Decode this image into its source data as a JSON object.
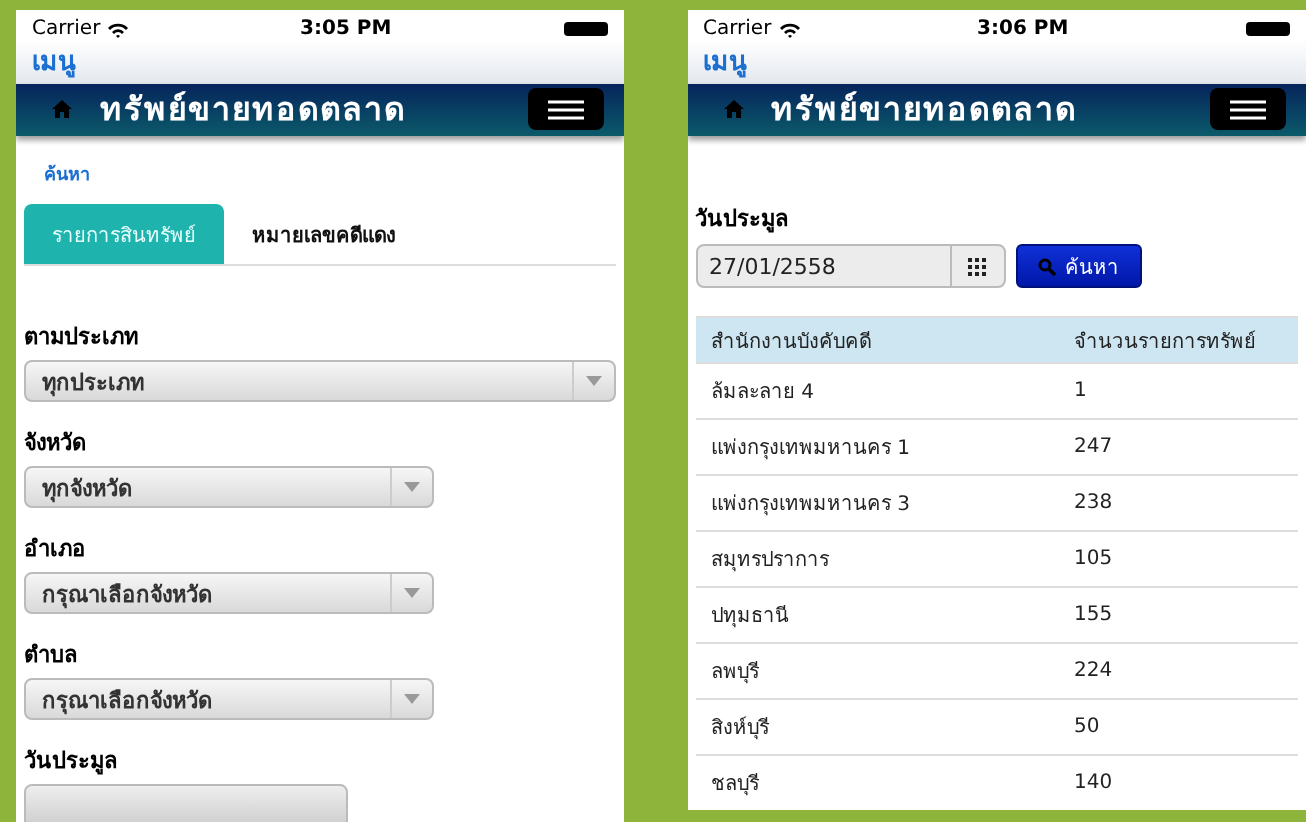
{
  "screens": [
    {
      "kind": "search_form",
      "status_bar": {
        "carrier": "Carrier",
        "time": "3:05 PM"
      },
      "menu_link": "เมนู",
      "header": {
        "title": "ทรัพย์ขายทอดตลาด"
      },
      "search_link": "ค้นหา",
      "tabs": [
        {
          "label": "รายการสินทรัพย์",
          "selected": true
        },
        {
          "label": "หมายเลขคดีแดง",
          "selected": false
        }
      ],
      "fields": [
        {
          "label": "ตามประเภท",
          "value": "ทุกประเภท",
          "kind": "wide"
        },
        {
          "label": "จังหวัด",
          "value": "ทุกจังหวัด",
          "kind": "narrow"
        },
        {
          "label": "อำเภอ",
          "value": "กรุณาเลือกจังหวัด",
          "kind": "narrow"
        },
        {
          "label": "ตำบล",
          "value": "กรุณาเลือกจังหวัด",
          "kind": "narrow"
        },
        {
          "label": "วันประมูล",
          "kind": "date"
        }
      ]
    },
    {
      "kind": "results",
      "status_bar": {
        "carrier": "Carrier",
        "time": "3:06 PM"
      },
      "menu_link": "เมนู",
      "header": {
        "title": "ทรัพย์ขายทอดตลาด"
      },
      "date_label": "วันประมูล",
      "date_value": "27/01/2558",
      "search_button": "ค้นหา",
      "table": {
        "columns": [
          "สำนักงานบังคับคดี",
          "จำนวนรายการทรัพย์"
        ],
        "rows": [
          [
            "ล้มละลาย 4",
            "1"
          ],
          [
            "แพ่งกรุงเทพมหานคร 1",
            "247"
          ],
          [
            "แพ่งกรุงเทพมหานคร 3",
            "238"
          ],
          [
            "สมุทรปราการ",
            "105"
          ],
          [
            "ปทุมธานี",
            "155"
          ],
          [
            "ลพบุรี",
            "224"
          ],
          [
            "สิงห์บุรี",
            "50"
          ],
          [
            "ชลบุรี",
            "140"
          ]
        ]
      }
    }
  ]
}
